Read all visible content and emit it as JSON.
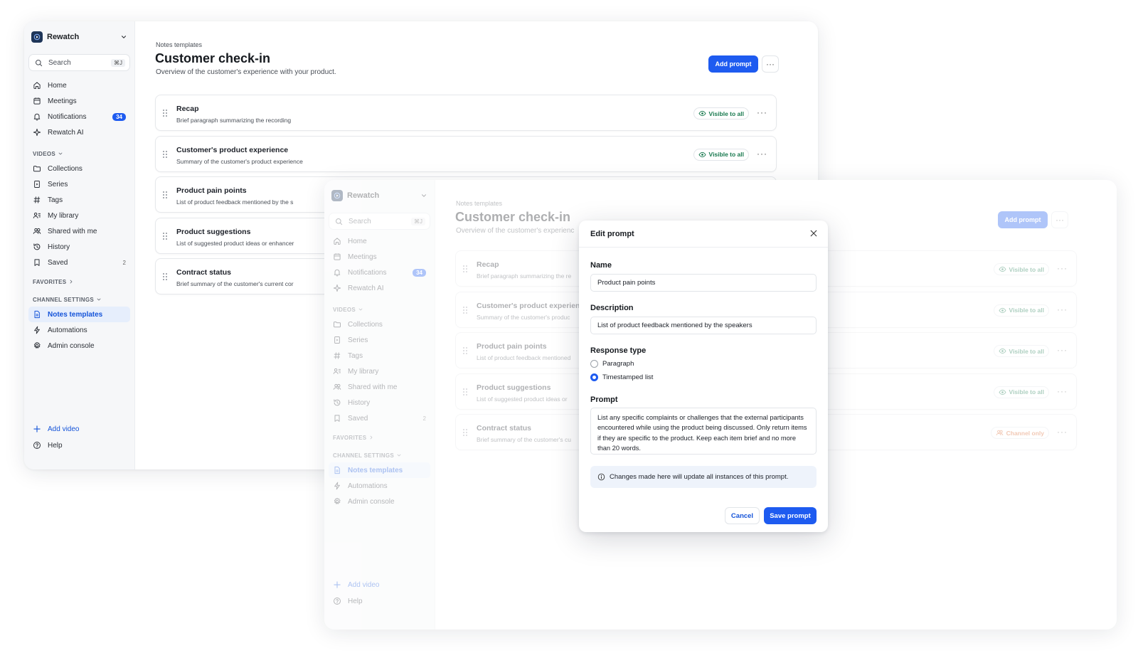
{
  "sidebar": {
    "workspace": "Rewatch",
    "search_placeholder": "Search",
    "search_shortcut": "⌘J",
    "nav": [
      {
        "label": "Home",
        "icon": "home-icon"
      },
      {
        "label": "Meetings",
        "icon": "calendar-icon"
      },
      {
        "label": "Notifications",
        "icon": "bell-icon",
        "badge": "34"
      },
      {
        "label": "Rewatch AI",
        "icon": "sparkle-icon"
      }
    ],
    "videos_section": "VIDEOS",
    "videos": [
      {
        "label": "Collections",
        "icon": "folder-icon"
      },
      {
        "label": "Series",
        "icon": "series-icon"
      },
      {
        "label": "Tags",
        "icon": "hash-icon"
      },
      {
        "label": "My library",
        "icon": "library-icon"
      },
      {
        "label": "Shared with me",
        "icon": "users-icon"
      },
      {
        "label": "History",
        "icon": "history-icon"
      },
      {
        "label": "Saved",
        "icon": "bookmark-icon",
        "count": "2"
      }
    ],
    "favorites_section": "FAVORITES",
    "channel_section": "CHANNEL SETTINGS",
    "channel": [
      {
        "label": "Notes templates",
        "icon": "document-icon",
        "active": true
      },
      {
        "label": "Automations",
        "icon": "bolt-icon"
      },
      {
        "label": "Admin console",
        "icon": "settings-icon"
      }
    ],
    "add_video": "Add video",
    "help": "Help"
  },
  "main": {
    "breadcrumb": "Notes templates",
    "title": "Customer check-in",
    "subtitle": "Overview of the customer's experience with your product.",
    "add_prompt": "Add prompt",
    "more": "···",
    "prompts": [
      {
        "title": "Recap",
        "desc": "Brief paragraph summarizing the recording",
        "visibility": "Visible to all"
      },
      {
        "title": "Customer's product experience",
        "desc": "Summary of the customer's product experience",
        "visibility": "Visible to all"
      },
      {
        "title": "Product pain points",
        "desc": "List of product feedback mentioned by the s",
        "visibility": "Visible to all"
      },
      {
        "title": "Product suggestions",
        "desc": "List of suggested product ideas or enhancer",
        "visibility": "Visible to all"
      },
      {
        "title": "Contract status",
        "desc": "Brief summary of the customer's current cor",
        "visibility": "Channel only"
      }
    ]
  },
  "back_window": {
    "prompts": [
      {
        "title": "Recap",
        "desc": "Brief paragraph summarizing the re",
        "visibility": "Visible to all"
      },
      {
        "title": "Customer's product experienc",
        "desc": "Summary of the customer's produc",
        "visibility": "Visible to all"
      },
      {
        "title": "Product pain points",
        "desc": "List of product feedback mentioned",
        "visibility": "Visible to all"
      },
      {
        "title": "Product suggestions",
        "desc": "List of suggested product ideas or",
        "visibility": "Visible to all"
      },
      {
        "title": "Contract status",
        "desc": "Brief summary of the customer's cu",
        "visibility": "Channel only"
      }
    ],
    "subtitle": "Overview of the customer's experienc"
  },
  "modal": {
    "title": "Edit prompt",
    "name_label": "Name",
    "name_value": "Product pain points",
    "desc_label": "Description",
    "desc_value": "List of product feedback mentioned by the speakers",
    "response_label": "Response type",
    "options": [
      "Paragraph",
      "Timestamped list"
    ],
    "selected": "Timestamped list",
    "prompt_label": "Prompt",
    "prompt_value": "List any specific complaints or challenges that the external participants encountered while using the product being discussed. Only return items if they are specific to the product. Keep each item brief and no more than 20 words.",
    "info": "Changes made here will update all instances of this prompt.",
    "cancel": "Cancel",
    "save": "Save prompt"
  },
  "colors": {
    "accent": "#1e5bf0",
    "visible": "#18794e",
    "channel": "#d9632c"
  }
}
